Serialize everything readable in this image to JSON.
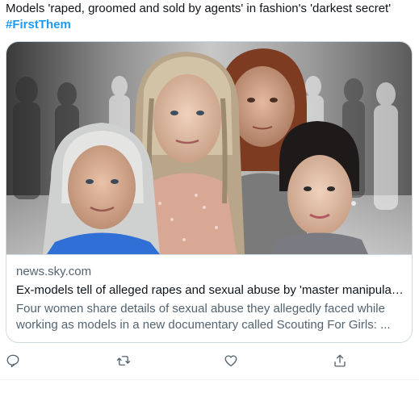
{
  "tweet": {
    "text": "Models 'raped, groomed and sold by agents' in fashion's 'darkest secret'",
    "hashtag": "#FirstThem"
  },
  "card": {
    "domain": "news.sky.com",
    "title": "Ex-models tell of alleged rapes and sexual abuse by 'master manipulat...",
    "description": "Four women share details of sexual abuse they allegedly faced while working as models in a new documentary called Scouting For Girls: ..."
  },
  "actions": [
    {
      "name": "reply",
      "icon": "reply-icon"
    },
    {
      "name": "retweet",
      "icon": "retweet-icon"
    },
    {
      "name": "like",
      "icon": "heart-icon"
    },
    {
      "name": "share",
      "icon": "share-icon"
    }
  ],
  "colors": {
    "text": "#0f1419",
    "secondary": "#536471",
    "accent": "#1d9bf0",
    "border": "#cfd9de"
  }
}
